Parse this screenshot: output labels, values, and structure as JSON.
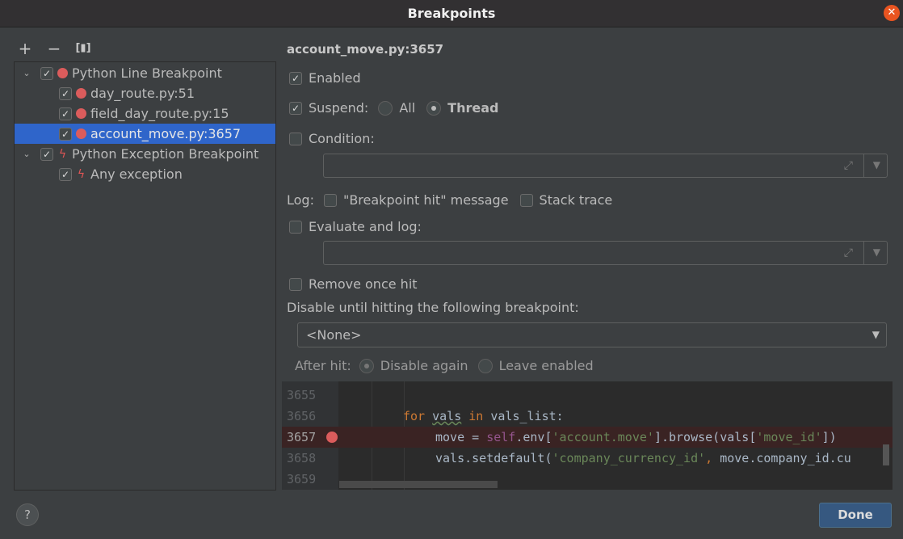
{
  "window": {
    "title": "Breakpoints",
    "close_icon": "close-icon"
  },
  "toolbar": {
    "add_label": "+",
    "remove_label": "−",
    "group_label": "[▮]"
  },
  "tree": {
    "items": [
      {
        "label": "Python Line Breakpoint",
        "checked": true,
        "icon": "breakpoint-dot-icon",
        "level": 0,
        "expanded": true
      },
      {
        "label": "day_route.py:51",
        "checked": true,
        "icon": "breakpoint-dot-icon",
        "level": 1
      },
      {
        "label": "field_day_route.py:15",
        "checked": true,
        "icon": "breakpoint-dot-icon",
        "level": 1
      },
      {
        "label": "account_move.py:3657",
        "checked": true,
        "icon": "breakpoint-dot-icon",
        "level": 1,
        "selected": true
      },
      {
        "label": "Python Exception Breakpoint",
        "checked": true,
        "icon": "lightning-icon",
        "level": 0,
        "expanded": true
      },
      {
        "label": "Any exception",
        "checked": true,
        "icon": "lightning-icon",
        "level": 1
      }
    ]
  },
  "detail": {
    "title": "account_move.py:3657",
    "enabled": {
      "label": "Enabled",
      "checked": true
    },
    "suspend": {
      "label": "Suspend:",
      "checked": true,
      "options": [
        "All",
        "Thread"
      ],
      "selected": "Thread"
    },
    "condition": {
      "label": "Condition:",
      "checked": false,
      "value": ""
    },
    "log": {
      "label": "Log:",
      "message": {
        "label": "\"Breakpoint hit\" message",
        "checked": false
      },
      "stack_trace": {
        "label": "Stack trace",
        "checked": false
      }
    },
    "evaluate": {
      "label": "Evaluate and log:",
      "checked": false,
      "value": ""
    },
    "remove_once_hit": {
      "label": "Remove once hit",
      "checked": false
    },
    "disable_until": {
      "label": "Disable until hitting the following breakpoint:",
      "value": "<None>"
    },
    "after_hit": {
      "label": "After hit:",
      "options": [
        "Disable again",
        "Leave enabled"
      ],
      "selected": "Disable again",
      "disabled": true
    }
  },
  "editor": {
    "lines": [
      {
        "number": "3655",
        "code": ""
      },
      {
        "number": "3656",
        "code": "for vals in vals_list:"
      },
      {
        "number": "3657",
        "code": "move = self.env['account.move'].browse(vals['move_id'])",
        "breakpoint": true
      },
      {
        "number": "3658",
        "code": "vals.setdefault('company_currency_id', move.company_id.cu"
      },
      {
        "number": "3659",
        "code": ""
      }
    ]
  },
  "footer": {
    "help_label": "?",
    "done_label": "Done"
  },
  "colors": {
    "accent": "#2f65ca",
    "breakpoint": "#db5c5c",
    "done_button": "#365880",
    "close_button": "#e95420"
  }
}
